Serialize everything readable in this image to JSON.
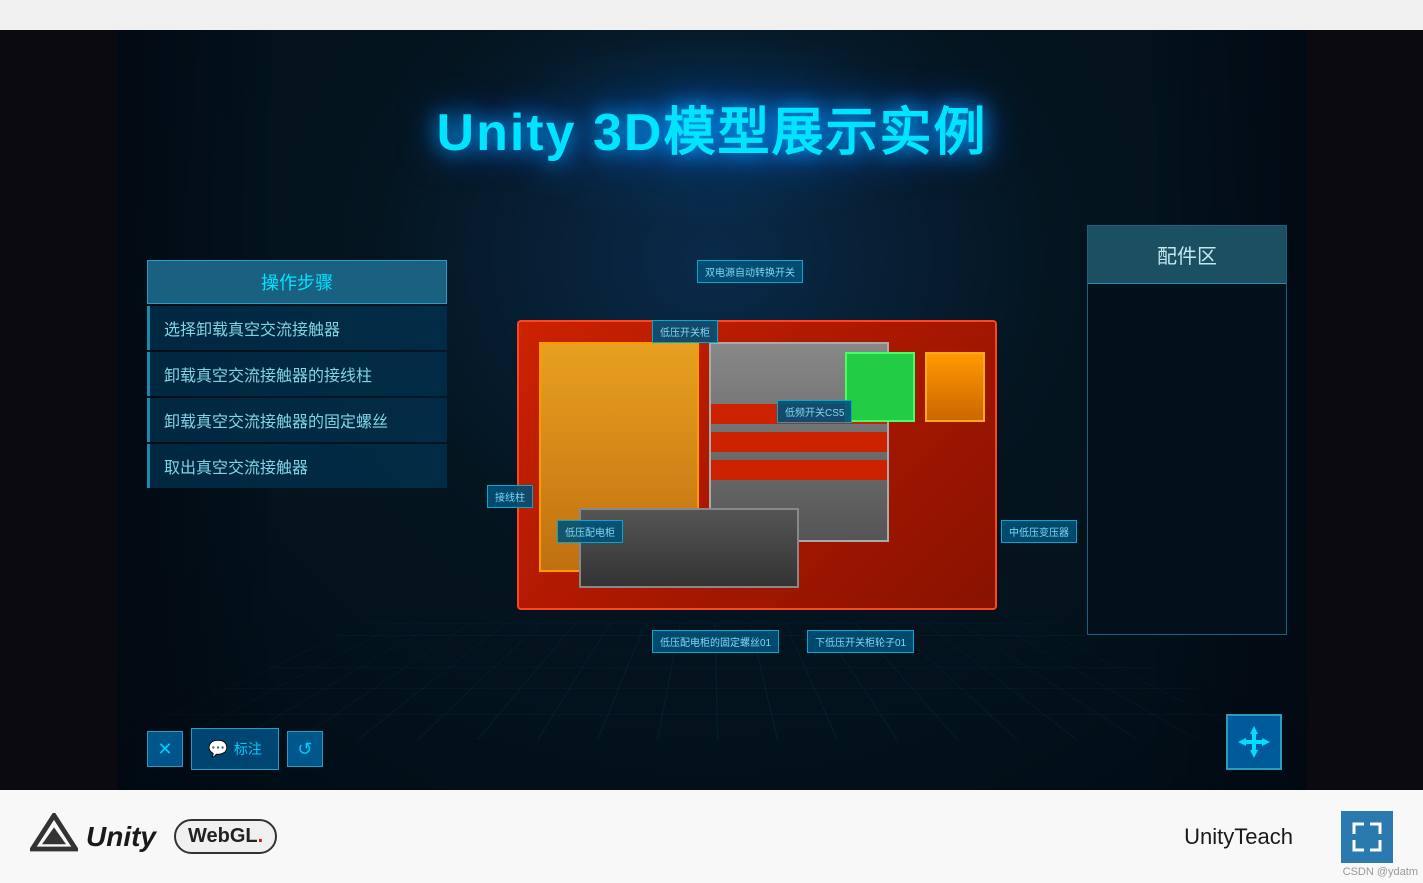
{
  "topBar": {},
  "canvas": {
    "title": "Unity 3D模型展示实例",
    "operationsPanel": {
      "header": "操作步骤",
      "steps": [
        "选择卸载真空交流接触器",
        "卸载真空交流接触器的接线柱",
        "卸载真空交流接触器的固定螺丝",
        "取出真空交流接触器"
      ]
    },
    "partsPanel": {
      "header": "配件区"
    },
    "machineLabels": [
      {
        "id": "label1",
        "text": "双电源自动转换开关"
      },
      {
        "id": "label2",
        "text": "低压开关柜"
      },
      {
        "id": "label3",
        "text": "低频开关CS5"
      },
      {
        "id": "label4",
        "text": "低压配电柜"
      },
      {
        "id": "label5",
        "text": "中低压变压器"
      },
      {
        "id": "label6",
        "text": "接线柱"
      },
      {
        "id": "label7",
        "text": "低压配电柜的固定螺丝01"
      },
      {
        "id": "label8",
        "text": "下低压开关柜轮子01"
      }
    ],
    "toolbar": {
      "closeLabel": "✕",
      "annotateLabel": "标注",
      "refreshLabel": "↺"
    },
    "moveBtn": "✛"
  },
  "bottomBar": {
    "unityText": "Unity",
    "webglText": "WebGL",
    "unityTeachLabel": "UnityTeach",
    "expandIcon": "⤢",
    "watermark": "CSDN @ydatm"
  }
}
